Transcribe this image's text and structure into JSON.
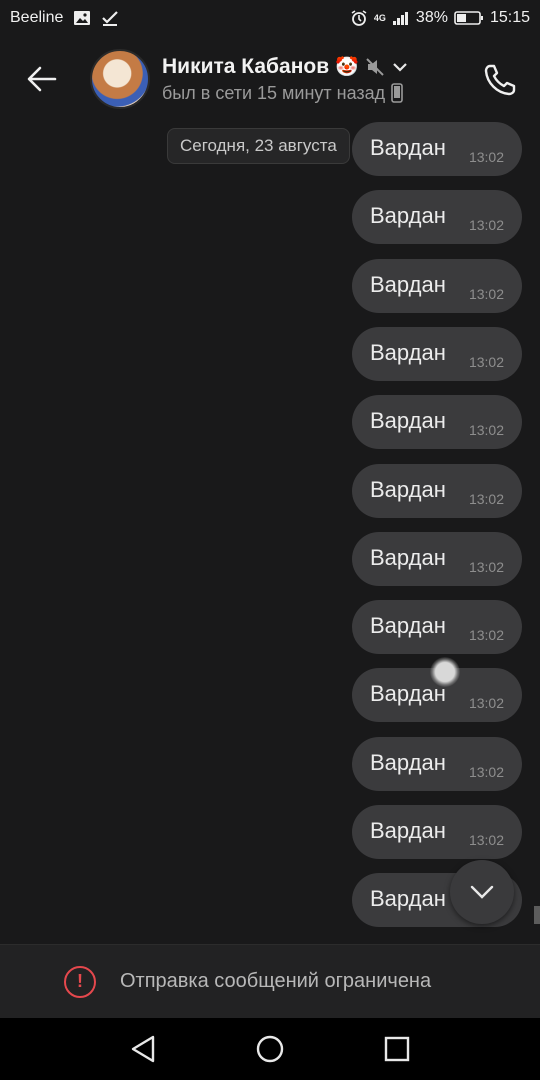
{
  "status_bar": {
    "carrier": "Beeline",
    "network": "4G",
    "battery": "38%",
    "time": "15:15"
  },
  "header": {
    "title": "Никита Кабанов",
    "title_emoji": "🤡",
    "subtitle": "был в сети 15 минут назад"
  },
  "chat": {
    "date_label": "Сегодня, 23 августа",
    "messages": [
      {
        "text": "Вардан",
        "time": "13:02"
      },
      {
        "text": "Вардан",
        "time": "13:02"
      },
      {
        "text": "Вардан",
        "time": "13:02"
      },
      {
        "text": "Вардан",
        "time": "13:02"
      },
      {
        "text": "Вардан",
        "time": "13:02"
      },
      {
        "text": "Вардан",
        "time": "13:02"
      },
      {
        "text": "Вардан",
        "time": "13:02"
      },
      {
        "text": "Вардан",
        "time": "13:02"
      },
      {
        "text": "Вардан",
        "time": "13:02"
      },
      {
        "text": "Вардан",
        "time": "13:02"
      },
      {
        "text": "Вардан",
        "time": "13:02"
      },
      {
        "text": "Вардан",
        "time": ""
      }
    ]
  },
  "footer": {
    "restriction_text": "Отправка сообщений ограничена"
  },
  "icons": {
    "back": "arrow-left-icon",
    "mute": "muted-speaker-icon",
    "dropdown": "chevron-down-icon",
    "device": "phone-device-icon",
    "call": "phone-call-icon",
    "scroll_down": "chevron-down-icon",
    "warning": "exclamation-circle-icon",
    "nav_back": "triangle-back-icon",
    "nav_home": "circle-home-icon",
    "nav_recents": "square-recents-icon"
  },
  "colors": {
    "background": "#19191a",
    "bubble": "#3b3b3d",
    "warning": "#e5484d"
  }
}
